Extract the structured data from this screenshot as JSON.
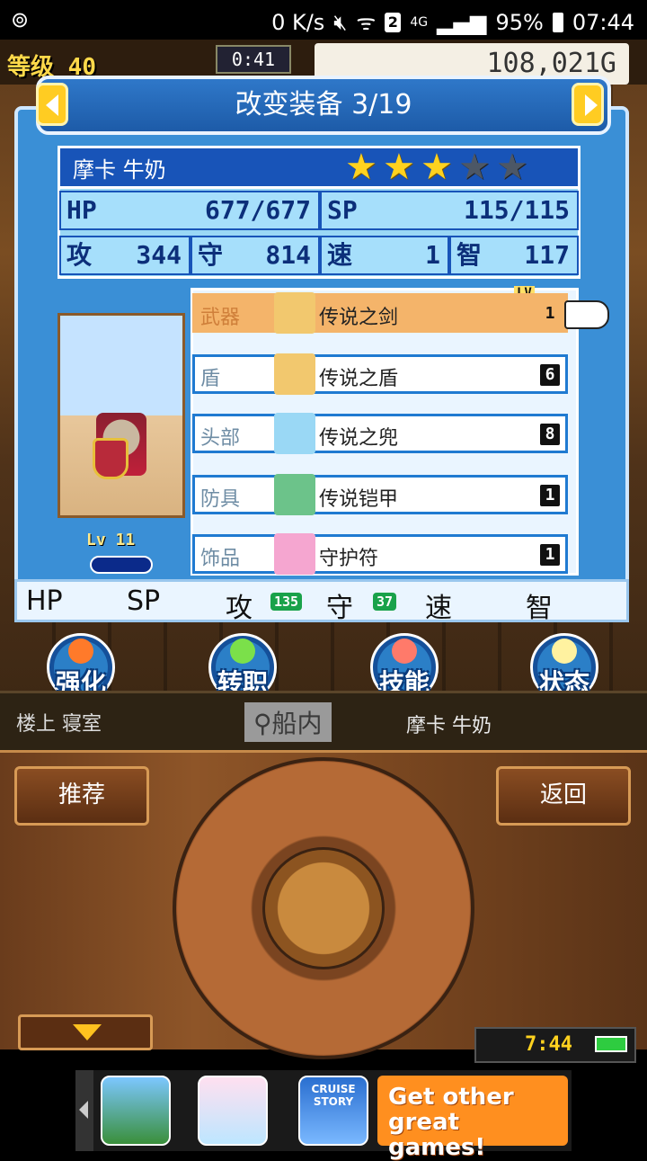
{
  "status_bar": {
    "network": "0 K/s",
    "sim": "2",
    "signal_type": "4G",
    "battery": "95%",
    "time": "07:44"
  },
  "game_header": {
    "level_label": "等级",
    "level": "40",
    "timer": "0:41",
    "gold": "108,021G"
  },
  "equip_panel": {
    "title": "改变装备 3/19",
    "character_name": "摩卡 牛奶",
    "star_rating": 3,
    "star_max": 5,
    "stats": {
      "hp_label": "HP",
      "hp_value": "677/677",
      "sp_label": "SP",
      "sp_value": "115/115",
      "atk_label": "攻",
      "atk_value": "344",
      "def_label": "守",
      "def_value": "814",
      "spd_label": "速",
      "spd_value": "1",
      "int_label": "智",
      "int_value": "117"
    },
    "portrait_level": "Lv 11",
    "lv_tag": "LV",
    "slots": [
      {
        "slot": "武器",
        "item": "传说之剑",
        "level": "1",
        "icon_color": "#f2c86e"
      },
      {
        "slot": "盾",
        "item": "传说之盾",
        "level": "6",
        "icon_color": "#f2c86e"
      },
      {
        "slot": "头部",
        "item": "传说之兜",
        "level": "8",
        "icon_color": "#9ad8f5"
      },
      {
        "slot": "防具",
        "item": "传说铠甲",
        "level": "1",
        "icon_color": "#6cc38a"
      },
      {
        "slot": "饰品",
        "item": "守护符",
        "level": "1",
        "icon_color": "#f5a6d0"
      }
    ],
    "strip": {
      "hp": "HP",
      "sp": "SP",
      "atk": "攻",
      "atk_bonus": "135",
      "def": "守",
      "def_bonus": "37",
      "spd": "速",
      "int": "智"
    }
  },
  "actions": [
    {
      "label": "强化",
      "icon": "up-arrow-icon",
      "color": "#ff7a2a"
    },
    {
      "label": "转职",
      "icon": "potion-icon",
      "color": "#7be04a"
    },
    {
      "label": "技能",
      "icon": "flame-icon",
      "color": "#ff7a6a"
    },
    {
      "label": "状态",
      "icon": "sparkle-icon",
      "color": "#fff2a0"
    }
  ],
  "location": {
    "room": "楼上 寝室",
    "area": "船内",
    "character": "摩卡 牛奶"
  },
  "controller": {
    "recommend": "推荐",
    "back": "返回",
    "clock": "7:44"
  },
  "ad": {
    "cta_line1": "Get other",
    "cta_line2": "great games!",
    "tile3_text": "CRUISE STORY"
  }
}
